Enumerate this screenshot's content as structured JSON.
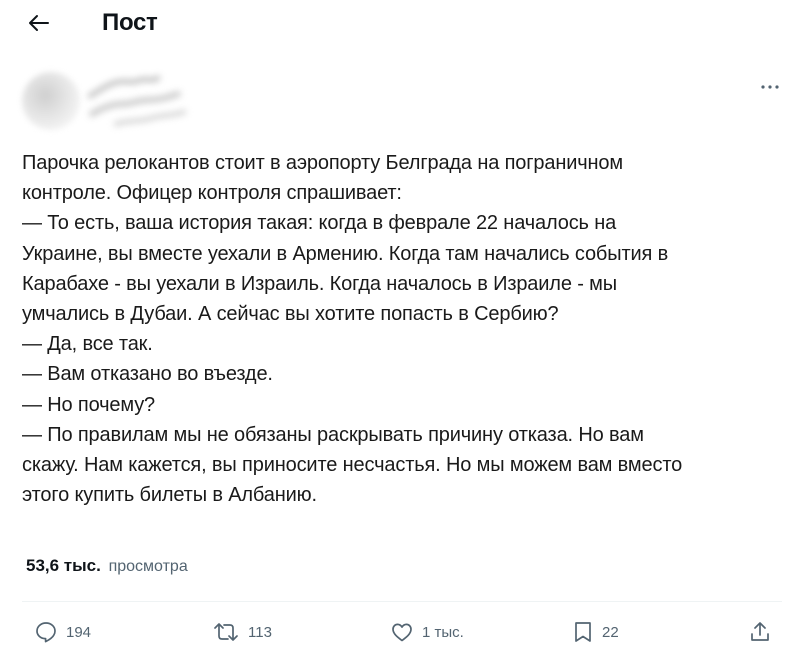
{
  "header": {
    "title": "Пост",
    "back_icon": "arrow-left-icon"
  },
  "post": {
    "lines": [
      "Парочка релокантов стоит в аэропорту Белграда на пограничном",
      "контроле. Офицер контроля спрашивает:",
      "— То есть, ваша история такая: когда в феврале 22 началось на",
      "Украине, вы вместе уехали в Армению. Когда там начались события в",
      "Карабахе - вы уехали в Израиль. Когда началось в Израиле - мы",
      "умчались в Дубаи. А сейчас вы хотите попасть в Сербию?",
      "— Да, все так.",
      "— Вам отказано во въезде.",
      "— Но почему?",
      "— По правилам мы не обязаны раскрывать причину отказа. Но вам",
      "скажу. Нам кажется, вы приносите несчастья. Но мы можем вам вместо",
      "этого купить билеты в Албанию."
    ]
  },
  "stats": {
    "views_count": "53,6 тыс.",
    "views_label": "просмотра"
  },
  "actions": {
    "replies": "194",
    "reposts": "113",
    "likes": "1 тыс.",
    "bookmarks": "22"
  },
  "colors": {
    "text": "#0f1419",
    "secondary": "#536471",
    "divider": "#eff3f4"
  }
}
